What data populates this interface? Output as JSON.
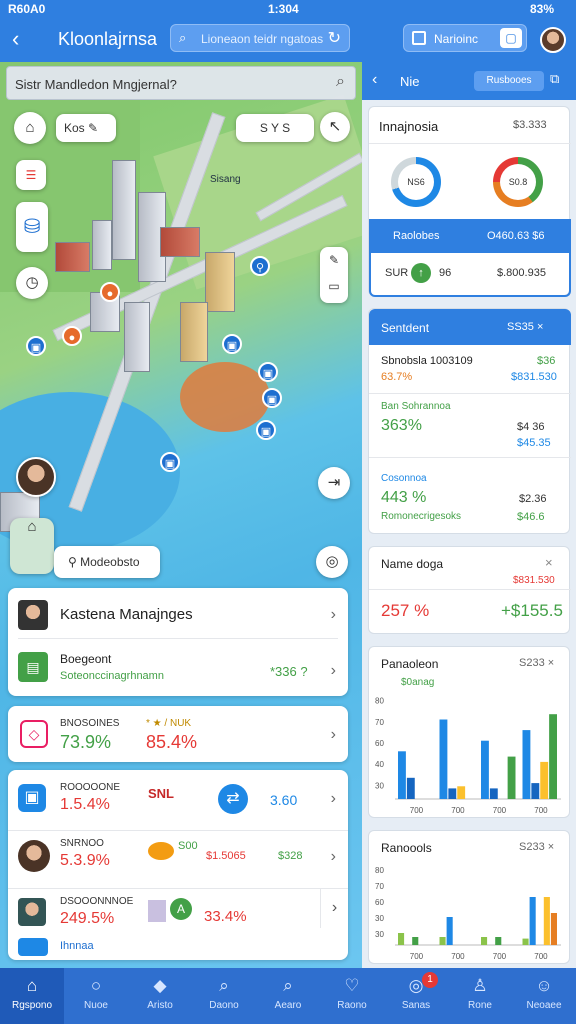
{
  "status": {
    "time": "1:304",
    "left": "R60A0",
    "battery": "83%"
  },
  "header": {
    "title": "Kloonlajrnsa",
    "search_placeholder": "Lioneaon teidr ngatoas",
    "right_label": "Narioinc"
  },
  "map": {
    "search_text": "Sistr Mandledon Mngjernal?",
    "chip_label": "Kos",
    "zoom_chip": "S Y S",
    "park_label": "Sisang",
    "location_pill": "Modeobsto"
  },
  "cards": {
    "c1": {
      "title": "Kastena Manajnges"
    },
    "c2": {
      "title": "Boegeont",
      "sub": "Soteonccinagrhnamn",
      "value": "*336 ?"
    },
    "c3": {
      "label": "BNOSOINES",
      "pct": "73.9%",
      "pct2": "85.4%",
      "mini": "* ★ / NUK"
    },
    "c4": {
      "label": "ROOOOONE",
      "pct": "1.5.4%",
      "badge": "SNL",
      "val": "3.60"
    },
    "c5": {
      "label": "SNRNOO",
      "pct": "5.3.9%",
      "mid": "S00",
      "v1": "$1.5065",
      "v2": "$328"
    },
    "c6": {
      "label": "DSOOONNNOE",
      "pct": "249.5%",
      "pct2": "33.4%",
      "badge": "A"
    },
    "c7": {
      "label": "Ihnnaa"
    }
  },
  "rpanel": {
    "head": "Nie",
    "head_btn": "Rusbooes",
    "summary": {
      "title": "Innajnosia",
      "value": "$3.333",
      "g1": "NS6",
      "g2": "S0.8",
      "band_l": "Raolobes",
      "band_r": "O460.63 $6",
      "row_l": "SUR",
      "row_m": "96",
      "row_r": "$.800.935"
    },
    "sentiment": {
      "head": "Sentdent",
      "head_r": "SS35 ×",
      "r1_t": "Sbnobsla 1003109",
      "r1_v": "$36",
      "r1_p": "63.7%",
      "r1_v2": "$831.530",
      "r2_t": "Ban Sohrannoa",
      "r2_p": "363%",
      "r2_v": "$4 36",
      "r2_v2": "$45.35",
      "r3_t": "Cosonnoa",
      "r3_p": "443 %",
      "r3_v": "$2.36",
      "r3_sub": "Romonecrigesoks",
      "r3_v2": "$46.6"
    },
    "name": {
      "title": "Name doga",
      "p": "257 %",
      "v": "+$155.5"
    },
    "chart1": {
      "title": "Panaoleon",
      "sub": "$0anag",
      "head_r": "S233 ×"
    },
    "chart2": {
      "title": "Ranoools",
      "head_r": "S233 ×"
    }
  },
  "chart_data": [
    {
      "type": "bar",
      "title": "Panaoleon",
      "categories": [
        "700",
        "700",
        "700",
        "700"
      ],
      "series": [
        {
          "color": "#1e88e5",
          "values": [
            45,
            75,
            55,
            65
          ]
        },
        {
          "color": "#1565c0",
          "values": [
            20,
            10,
            10,
            15
          ]
        },
        {
          "color": "#fbc02d",
          "values": [
            0,
            12,
            0,
            35
          ]
        },
        {
          "color": "#43a047",
          "values": [
            0,
            0,
            40,
            80
          ]
        }
      ],
      "ylim": [
        0,
        100
      ],
      "yticks": [
        "80",
        "70",
        "60",
        "40",
        "30"
      ]
    },
    {
      "type": "bar",
      "title": "Ranoools",
      "categories": [
        "700",
        "700",
        "700",
        "700"
      ],
      "series": [
        {
          "color": "#8bc34a",
          "values": [
            15,
            10,
            10,
            8
          ]
        },
        {
          "color": "#1e88e5",
          "values": [
            0,
            35,
            0,
            60
          ]
        },
        {
          "color": "#43a047",
          "values": [
            10,
            0,
            10,
            0
          ]
        },
        {
          "color": "#fbc02d",
          "values": [
            0,
            0,
            0,
            60
          ]
        },
        {
          "color": "#e67e22",
          "values": [
            0,
            0,
            0,
            40
          ]
        }
      ],
      "ylim": [
        0,
        100
      ],
      "yticks": [
        "80",
        "70",
        "60",
        "30",
        "30"
      ]
    }
  ],
  "nav": [
    {
      "label": "Rgspono",
      "icon": "⌂"
    },
    {
      "label": "Nuoe",
      "icon": "○"
    },
    {
      "label": "Aristo",
      "icon": "◆"
    },
    {
      "label": "Daono",
      "icon": "⌕"
    },
    {
      "label": "Aearo",
      "icon": "⌕"
    },
    {
      "label": "Raono",
      "icon": "♡"
    },
    {
      "label": "Sanas",
      "icon": "◎"
    },
    {
      "label": "Rone",
      "icon": "♙"
    },
    {
      "label": "Neoaee",
      "icon": "☺"
    }
  ],
  "badge_count": "1"
}
